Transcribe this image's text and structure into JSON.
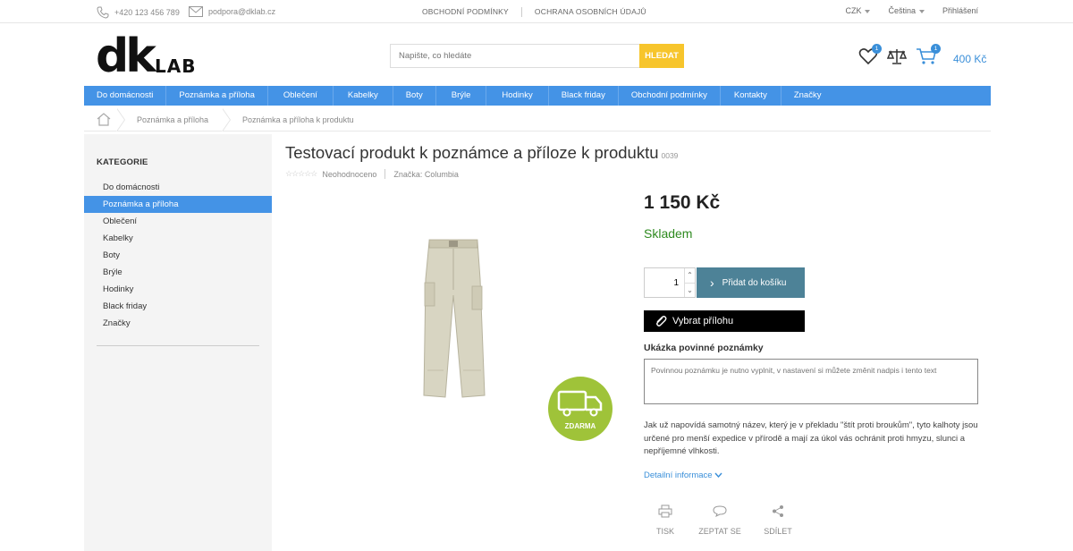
{
  "topbar": {
    "phone": "+420 123 456 789",
    "email": "podpora@dklab.cz",
    "links": [
      "OBCHODNÍ PODMÍNKY",
      "OCHRANA OSOBNÍCH ÚDAJŮ"
    ],
    "currency": "CZK",
    "language": "Čeština",
    "login": "Přihlášení"
  },
  "header": {
    "logo_main": "dk",
    "logo_sub": "LAB",
    "search_placeholder": "Napište, co hledáte",
    "search_button": "HLEDAT",
    "wishlist_count": "1",
    "cart_count": "1",
    "cart_total": "400 Kč"
  },
  "nav": [
    "Do domácnosti",
    "Poznámka a příloha",
    "Oblečení",
    "Kabelky",
    "Boty",
    "Brýle",
    "Hodinky",
    "Black friday",
    "Obchodní podmínky",
    "Kontakty",
    "Značky"
  ],
  "breadcrumb": [
    "Poznámka a příloha",
    "Poznámka a příloha k produktu"
  ],
  "sidebar": {
    "title": "KATEGORIE",
    "items": [
      "Do domácnosti",
      "Poznámka a příloha",
      "Oblečení",
      "Kabelky",
      "Boty",
      "Brýle",
      "Hodinky",
      "Black friday",
      "Značky"
    ],
    "active_index": 1
  },
  "product": {
    "title": "Testovací produkt k poznámce a příloze k produktu",
    "code": "0039",
    "rating_text": "Neohodnoceno",
    "brand": "Značka: Columbia",
    "price": "1 150 Kč",
    "availability": "Skladem",
    "quantity": "1",
    "add_to_cart": "Přidat do košíku",
    "attachment_button": "Vybrat přílohu",
    "note_label": "Ukázka povinné poznámky",
    "note_placeholder": "Povinnou poznámku je nutno vyplnit, v nastavení si můžete změnit nadpis i tento text",
    "description": "Jak už napovídá samotný název, který je v překladu \"štít proti broukům\", tyto kalhoty jsou určené pro menší expedice v přírodě a mají za úkol vás ochránit proti hmyzu, slunci a nepříjemné vlhkosti.",
    "detail_link": "Detailní informace",
    "free_shipping": "ZDARMA"
  },
  "actions": [
    "TISK",
    "ZEPTAT SE",
    "SDÍLET"
  ],
  "colors": {
    "accent": "#4493e6",
    "search_button": "#f7c52c",
    "cart_button": "#4d8297",
    "stock": "#2e8a1f",
    "shipping_badge": "#9fc339"
  }
}
